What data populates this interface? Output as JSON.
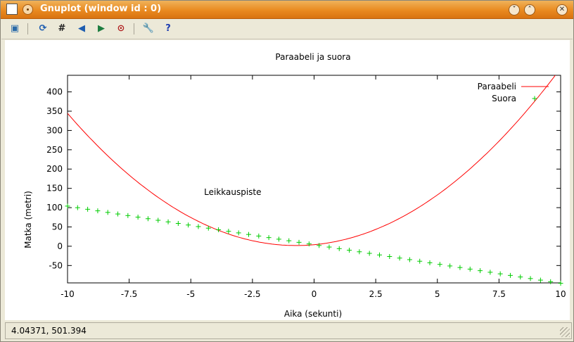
{
  "window": {
    "title": "Gnuplot (window id : 0)"
  },
  "toolbar": {
    "buttons": [
      {
        "name": "copy-to-clipboard-icon",
        "glyph": "▣"
      },
      {
        "name": "replot-icon",
        "glyph": "⟳"
      },
      {
        "name": "grid-icon",
        "glyph": "#"
      },
      {
        "name": "previous-zoom-icon",
        "glyph": "◀"
      },
      {
        "name": "next-zoom-icon",
        "glyph": "▶"
      },
      {
        "name": "autoscale-icon",
        "glyph": "⊙"
      },
      {
        "name": "settings-icon",
        "glyph": "🔧"
      },
      {
        "name": "help-icon",
        "glyph": "?"
      }
    ]
  },
  "chart_data": {
    "type": "line",
    "title": "Paraabeli ja suora",
    "xlabel": "Aika (sekunti)",
    "ylabel": "Matka (metri)",
    "xlim": [
      -10,
      10
    ],
    "ylim": [
      -95,
      443
    ],
    "xticks": [
      "-10",
      "-7.5",
      "-5",
      "-2.5",
      "0",
      "2.5",
      "5",
      "7.5",
      "10"
    ],
    "xtick_values": [
      -10,
      -7.5,
      -5,
      -2.5,
      0,
      2.5,
      5,
      7.5,
      10
    ],
    "yticks": [
      "-50",
      "0",
      "50",
      "100",
      "150",
      "200",
      "250",
      "300",
      "350",
      "400"
    ],
    "ytick_values": [
      -50,
      0,
      50,
      100,
      150,
      200,
      250,
      300,
      350,
      400
    ],
    "legend_position": "top-right",
    "series": [
      {
        "name": "Paraabeli",
        "style": "line",
        "color": "#ff0000",
        "x": [
          -10,
          -8,
          -6,
          -4,
          -2,
          -1,
          0,
          1,
          2,
          4,
          6,
          8,
          10
        ],
        "y": [
          346,
          214,
          114,
          45,
          5,
          -3,
          -1,
          9,
          29,
          97,
          195,
          322,
          443
        ]
      },
      {
        "name": "Suora",
        "style": "points",
        "marker": "+",
        "color": "#00cc00",
        "x": [
          -10,
          10
        ],
        "y": [
          104,
          -96
        ],
        "npoints": 50
      }
    ],
    "annotations": [
      {
        "text": "Leikkauspiste",
        "x": -3.3,
        "y": 140
      }
    ]
  },
  "status": {
    "coords": "4.04371,  501.394"
  },
  "colors": {
    "titlebar": "#e98a20",
    "parabola": "#ff0000",
    "line": "#00cc00"
  }
}
